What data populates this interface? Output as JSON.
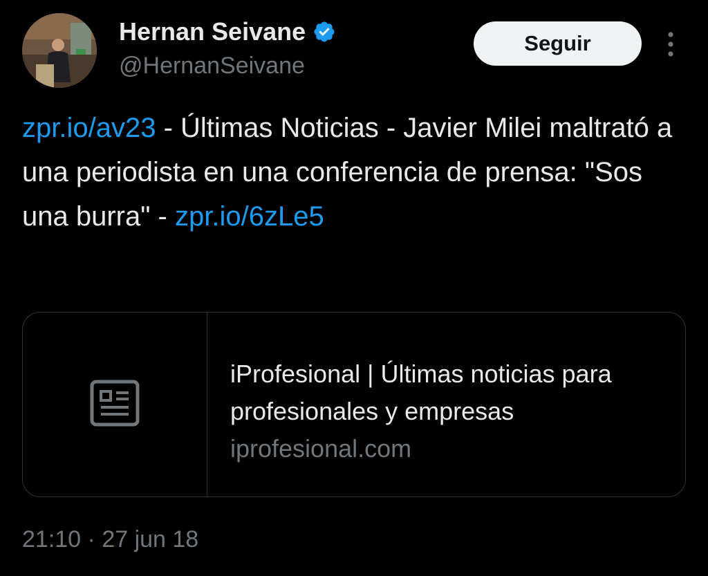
{
  "author": {
    "display_name": "Hernan Seivane",
    "handle": "@HernanSeivane",
    "verified_icon": "verified-badge-icon"
  },
  "actions": {
    "follow_label": "Seguir",
    "more_icon": "more-options-icon"
  },
  "tweet": {
    "link1": "zpr.io/av23",
    "text": " - Últimas Noticias - Javier Milei maltrató a una periodista en una conferencia de prensa: \"Sos una burra\" - ",
    "link2": "zpr.io/6zLe5"
  },
  "card": {
    "icon": "article-icon",
    "title": "iProfesional | Últimas noticias para profesionales y empresas",
    "domain": "iprofesional.com"
  },
  "meta": {
    "time": "21:10",
    "separator": " · ",
    "date": "27 jun 18"
  },
  "colors": {
    "background": "#000000",
    "link": "#1d9bf0",
    "primary_text": "#e7e9ea",
    "secondary_text": "#71767b",
    "verified": "#1d9bf0",
    "border": "#2f3336"
  }
}
